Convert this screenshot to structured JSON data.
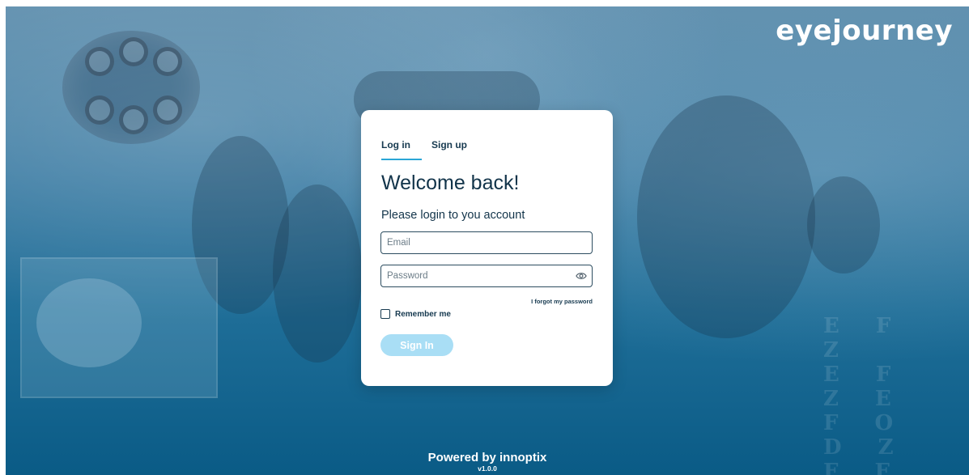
{
  "brand": {
    "logo_text": "eyejourney"
  },
  "tabs": [
    {
      "label": "Log in",
      "active": true
    },
    {
      "label": "Sign up",
      "active": false
    }
  ],
  "login": {
    "title": "Welcome back!",
    "subtitle": "Please login to you account",
    "email_placeholder": "Email",
    "email_value": "",
    "password_placeholder": "Password",
    "password_value": "",
    "forgot_label": "I forgot my password",
    "remember_label": "Remember me",
    "remember_checked": false,
    "signin_label": "Sign In"
  },
  "footer": {
    "powered_by": "Powered by innoptix",
    "version": "v1.0.0"
  },
  "colors": {
    "accent": "#2aa6d6",
    "signin_bg": "#a9def5",
    "text_dark": "#12344a"
  },
  "icons": {
    "password_toggle": "eye-icon"
  }
}
